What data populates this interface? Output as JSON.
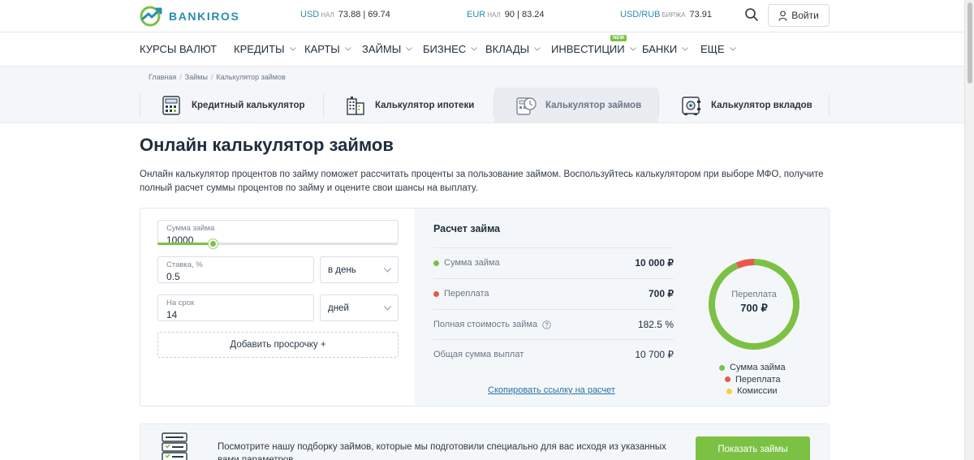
{
  "header": {
    "logo_text": "BANKIROS",
    "rates": [
      {
        "currency": "USD",
        "kind": "НАЛ",
        "value": "73.88 | 69.74"
      },
      {
        "currency": "EUR",
        "kind": "НАЛ",
        "value": "90 | 83.24"
      },
      {
        "currency": "USD/RUB",
        "kind": "БИРЖА",
        "value": "73.91"
      }
    ],
    "login_label": "Войти"
  },
  "nav": {
    "items": [
      "КУРСЫ ВАЛЮТ",
      "КРЕДИТЫ",
      "КАРТЫ",
      "ЗАЙМЫ",
      "БИЗНЕС",
      "ВКЛАДЫ",
      "ИНВЕСТИЦИИ",
      "БАНКИ",
      "ЕЩЕ"
    ],
    "new_badge": "NEW"
  },
  "breadcrumbs": [
    "Главная",
    "Займы",
    "Калькулятор займов"
  ],
  "calc_tabs": [
    "Кредитный калькулятор",
    "Калькулятор ипотеки",
    "Калькулятор займов",
    "Калькулятор вкладов"
  ],
  "page": {
    "title": "Онлайн калькулятор займов",
    "intro": "Онлайн калькулятор процентов по займу поможет рассчитать проценты за пользование займом. Воспользуйтесь калькулятором при выборе МФО, получите полный расчет суммы процентов по займу и оцените свои шансы на выплату."
  },
  "form": {
    "amount_label": "Сумма займа",
    "amount_value": "10000",
    "amount_slider_fraction": 0.23,
    "rate_label": "Ставка, %",
    "rate_value": "0.5",
    "rate_period": "в день",
    "term_label": "На срок",
    "term_value": "14",
    "term_unit": "дней",
    "add_delay_label": "Добавить просрочку +"
  },
  "result": {
    "title": "Расчет займа",
    "rows": [
      {
        "label": "Сумма займа",
        "value": "10 000 ₽"
      },
      {
        "label": "Переплата",
        "value": "700 ₽"
      },
      {
        "label": "Полная стоимость займа",
        "value": "182.5 %"
      },
      {
        "label": "Общая сумма выплат",
        "value": "10 700 ₽"
      }
    ],
    "copy_link": "Скопировать ссылку на расчет",
    "donut_label": "Переплата",
    "donut_value": "700 ₽",
    "legend": [
      "Сумма займа",
      "Переплата",
      "Комиссии"
    ]
  },
  "chart_data": {
    "type": "pie",
    "categories": [
      "Сумма займа",
      "Переплата",
      "Комиссии"
    ],
    "values": [
      10000,
      700,
      0
    ],
    "colors": [
      "#7cc144",
      "#e8584b",
      "#f2d43a"
    ]
  },
  "promo": {
    "text": "Посмотрите нашу подборку займов, которые мы подготовили специально для вас исходя из указанных вами параметров",
    "button_label": "Показать займы"
  },
  "colors": {
    "brand": "#2a8cb3",
    "accent_green": "#7cc144",
    "accent_red": "#e8584b",
    "accent_yellow": "#f2d43a",
    "link": "#2a6fa3"
  }
}
